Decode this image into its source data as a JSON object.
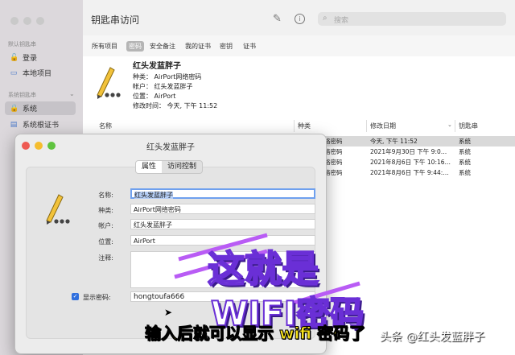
{
  "window": {
    "title": "钥匙串访问",
    "search_placeholder": "搜索"
  },
  "sidebar": {
    "section1": "默认钥匙串",
    "items1": [
      {
        "label": "登录"
      },
      {
        "label": "本地项目"
      }
    ],
    "section2": "系统钥匙串",
    "items2": [
      {
        "label": "系统"
      },
      {
        "label": "系统根证书"
      }
    ]
  },
  "tabs": [
    "所有项目",
    "密码",
    "安全备注",
    "我的证书",
    "密钥",
    "证书"
  ],
  "detail": {
    "name": "红头发蓝胖子",
    "kind_label": "种类：",
    "kind_value": "AirPort网络密码",
    "account_label": "帐户：",
    "account_value": "红头发蓝胖子",
    "where_label": "位置：",
    "where_value": "AirPort",
    "modified_label": "修改时间：",
    "modified_value": "今天, 下午 11:52"
  },
  "table": {
    "headers": [
      "名称",
      "种类",
      "修改日期",
      "钥匙串"
    ],
    "rows": [
      {
        "kind": "络密码",
        "date": "今天, 下午 11:52",
        "keychain": "系统"
      },
      {
        "kind": "络密码",
        "date": "2021年9月30日 下午 9:0…",
        "keychain": "系统"
      },
      {
        "kind": "络密码",
        "date": "2021年8月6日 下午 10:16…",
        "keychain": "系统"
      },
      {
        "kind": "络密码",
        "date": "2021年8月6日 下午 9:44:…",
        "keychain": "系统"
      }
    ]
  },
  "dialog": {
    "title": "红头发蓝胖子",
    "tab_attributes": "属性",
    "tab_access": "访问控制",
    "name_label": "名称:",
    "name_value": "红头发蓝胖子",
    "kind_label": "种类:",
    "kind_value": "AirPort网络密码",
    "account_label": "帐户:",
    "account_value": "红头发蓝胖子",
    "where_label": "位置:",
    "where_value": "AirPort",
    "comments_label": "注释:",
    "show_password_label": "显示密码:",
    "show_password_checked": true,
    "password_value": "hongtoufa666"
  },
  "overlay": {
    "line1": "这就是",
    "line2": "WIFI密码",
    "subtitle": "输入后就可以显示 wifi 密码了",
    "watermark": "头条 @红头发蓝胖子"
  },
  "colors": {
    "accent_blue": "#2f6fde",
    "close_red": "#ee5a52",
    "minimize_yellow": "#f5bd2e",
    "zoom_green": "#5fc33f",
    "subtitle_yellow": "#f7e21a"
  }
}
